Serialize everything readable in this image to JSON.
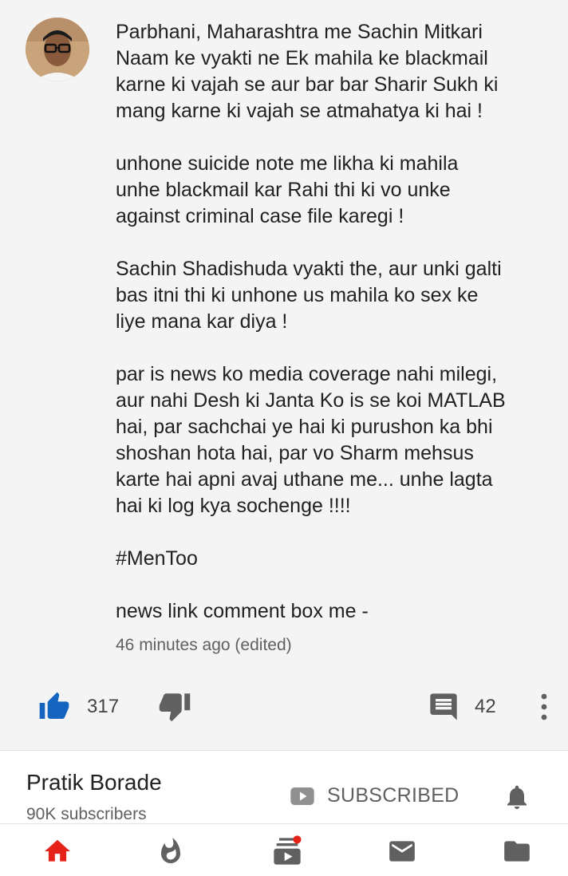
{
  "post": {
    "paragraphs": [
      "Parbhani, Maharashtra me Sachin Mitkari\nNaam ke vyakti ne Ek mahila ke blackmail\nkarne ki vajah se aur bar bar Sharir Sukh ki\nmang karne ki vajah se atmahatya ki hai !",
      "unhone suicide note me likha ki mahila\nunhe blackmail kar Rahi thi ki vo unke\nagainst criminal case file karegi !",
      "Sachin Shadishuda vyakti the, aur unki galti\nbas itni thi ki unhone us mahila ko sex ke\nliye mana kar diya !",
      "par is news ko media coverage nahi milegi,\naur nahi Desh ki Janta Ko is se koi MATLAB\nhai, par sachchai ye hai ki purushon ka bhi\nshoshan hota hai, par vo Sharm mehsus\nkarte hai apni avaj uthane me... unhe lagta\nhai ki log kya sochenge !!!!"
    ],
    "hashtag": "#MenToo",
    "news_link_text": "news link comment box me -",
    "timestamp": "46 minutes ago (edited)"
  },
  "actions": {
    "like_count": "317",
    "comment_count": "42",
    "like_color": "#1565c0",
    "icon_color": "#606060"
  },
  "channel": {
    "name": "Pratik Borade",
    "subscribers": "90K subscribers",
    "subscribe_label": "SUBSCRIBED"
  },
  "nav": {
    "items": [
      "home-icon",
      "trending-icon",
      "subscriptions-icon",
      "inbox-icon",
      "library-icon"
    ],
    "active_color": "#e62117",
    "inactive_color": "#606060"
  }
}
